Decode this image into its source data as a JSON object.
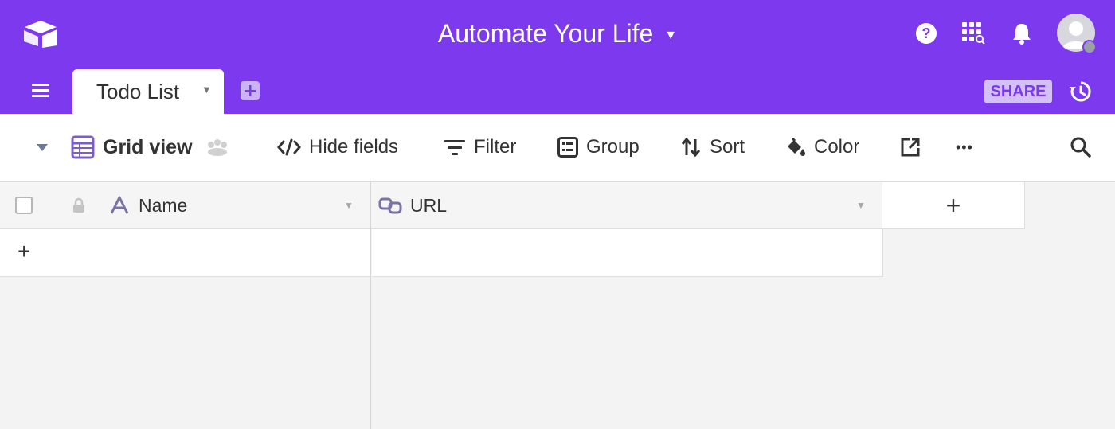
{
  "header": {
    "app_title": "Automate Your Life",
    "brand_color": "#7c39ed",
    "icons": [
      "airtable-logo-icon",
      "help-icon",
      "apps-search-icon",
      "notification-bell-icon",
      "user-avatar-icon"
    ]
  },
  "tabs_bar": {
    "tabs": [
      {
        "label": "Todo List",
        "active": true
      }
    ],
    "share_label": "SHARE"
  },
  "toolbar": {
    "view_name": "Grid view",
    "hide_fields_label": "Hide fields",
    "filter_label": "Filter",
    "group_label": "Group",
    "sort_label": "Sort",
    "color_label": "Color",
    "more_label": "•••"
  },
  "grid": {
    "columns": [
      {
        "name": "Name",
        "type_icon": "text-field-icon"
      },
      {
        "name": "URL",
        "type_icon": "url-link-icon"
      }
    ],
    "add_field_label": "+",
    "add_row_label": "+",
    "rows": []
  }
}
